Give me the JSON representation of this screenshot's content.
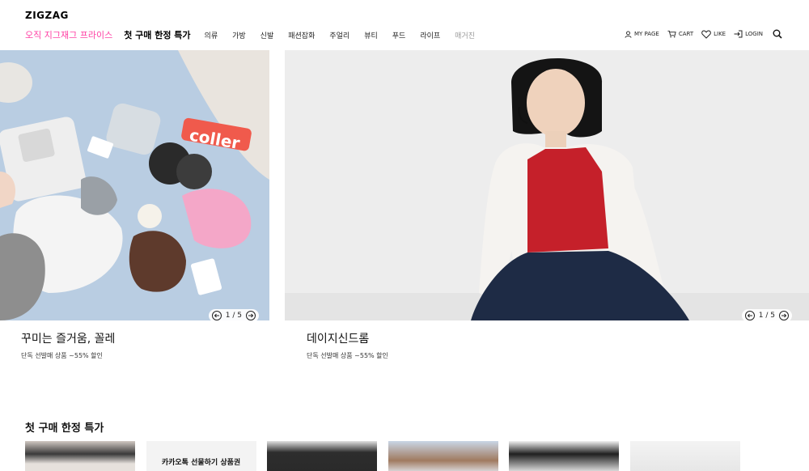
{
  "header": {
    "logo": "ZIGZAG",
    "nav": [
      {
        "label": "오직 지그재그 프라이스",
        "style": "pink"
      },
      {
        "label": "첫 구매 한정 특가",
        "style": "bold"
      },
      {
        "label": "의류",
        "style": "normal"
      },
      {
        "label": "가방",
        "style": "normal"
      },
      {
        "label": "신발",
        "style": "normal"
      },
      {
        "label": "패션잡화",
        "style": "normal"
      },
      {
        "label": "주얼리",
        "style": "normal"
      },
      {
        "label": "뷰티",
        "style": "normal"
      },
      {
        "label": "푸드",
        "style": "normal"
      },
      {
        "label": "라이프",
        "style": "normal"
      },
      {
        "label": "매거진",
        "style": "muted"
      }
    ],
    "util": {
      "mypage": "MY PAGE",
      "cart": "CART",
      "like": "LIKE",
      "login": "LOGIN"
    }
  },
  "banners": [
    {
      "title": "꾸미는 즐거움, 꼴레",
      "subtitle": "단독 선발매 상품 ~55% 할인",
      "page": "1 / 5"
    },
    {
      "title": "데이지신드롬",
      "subtitle": "단독 선발매 상품 ~55% 할인",
      "page": "1 / 5"
    }
  ],
  "section": {
    "title": "첫 구매 한정 특가",
    "voucher_label": "카카오톡 선물하기 상품권"
  },
  "colors": {
    "accent_pink": "#ff3fa4",
    "muted": "#9a9a9a"
  }
}
